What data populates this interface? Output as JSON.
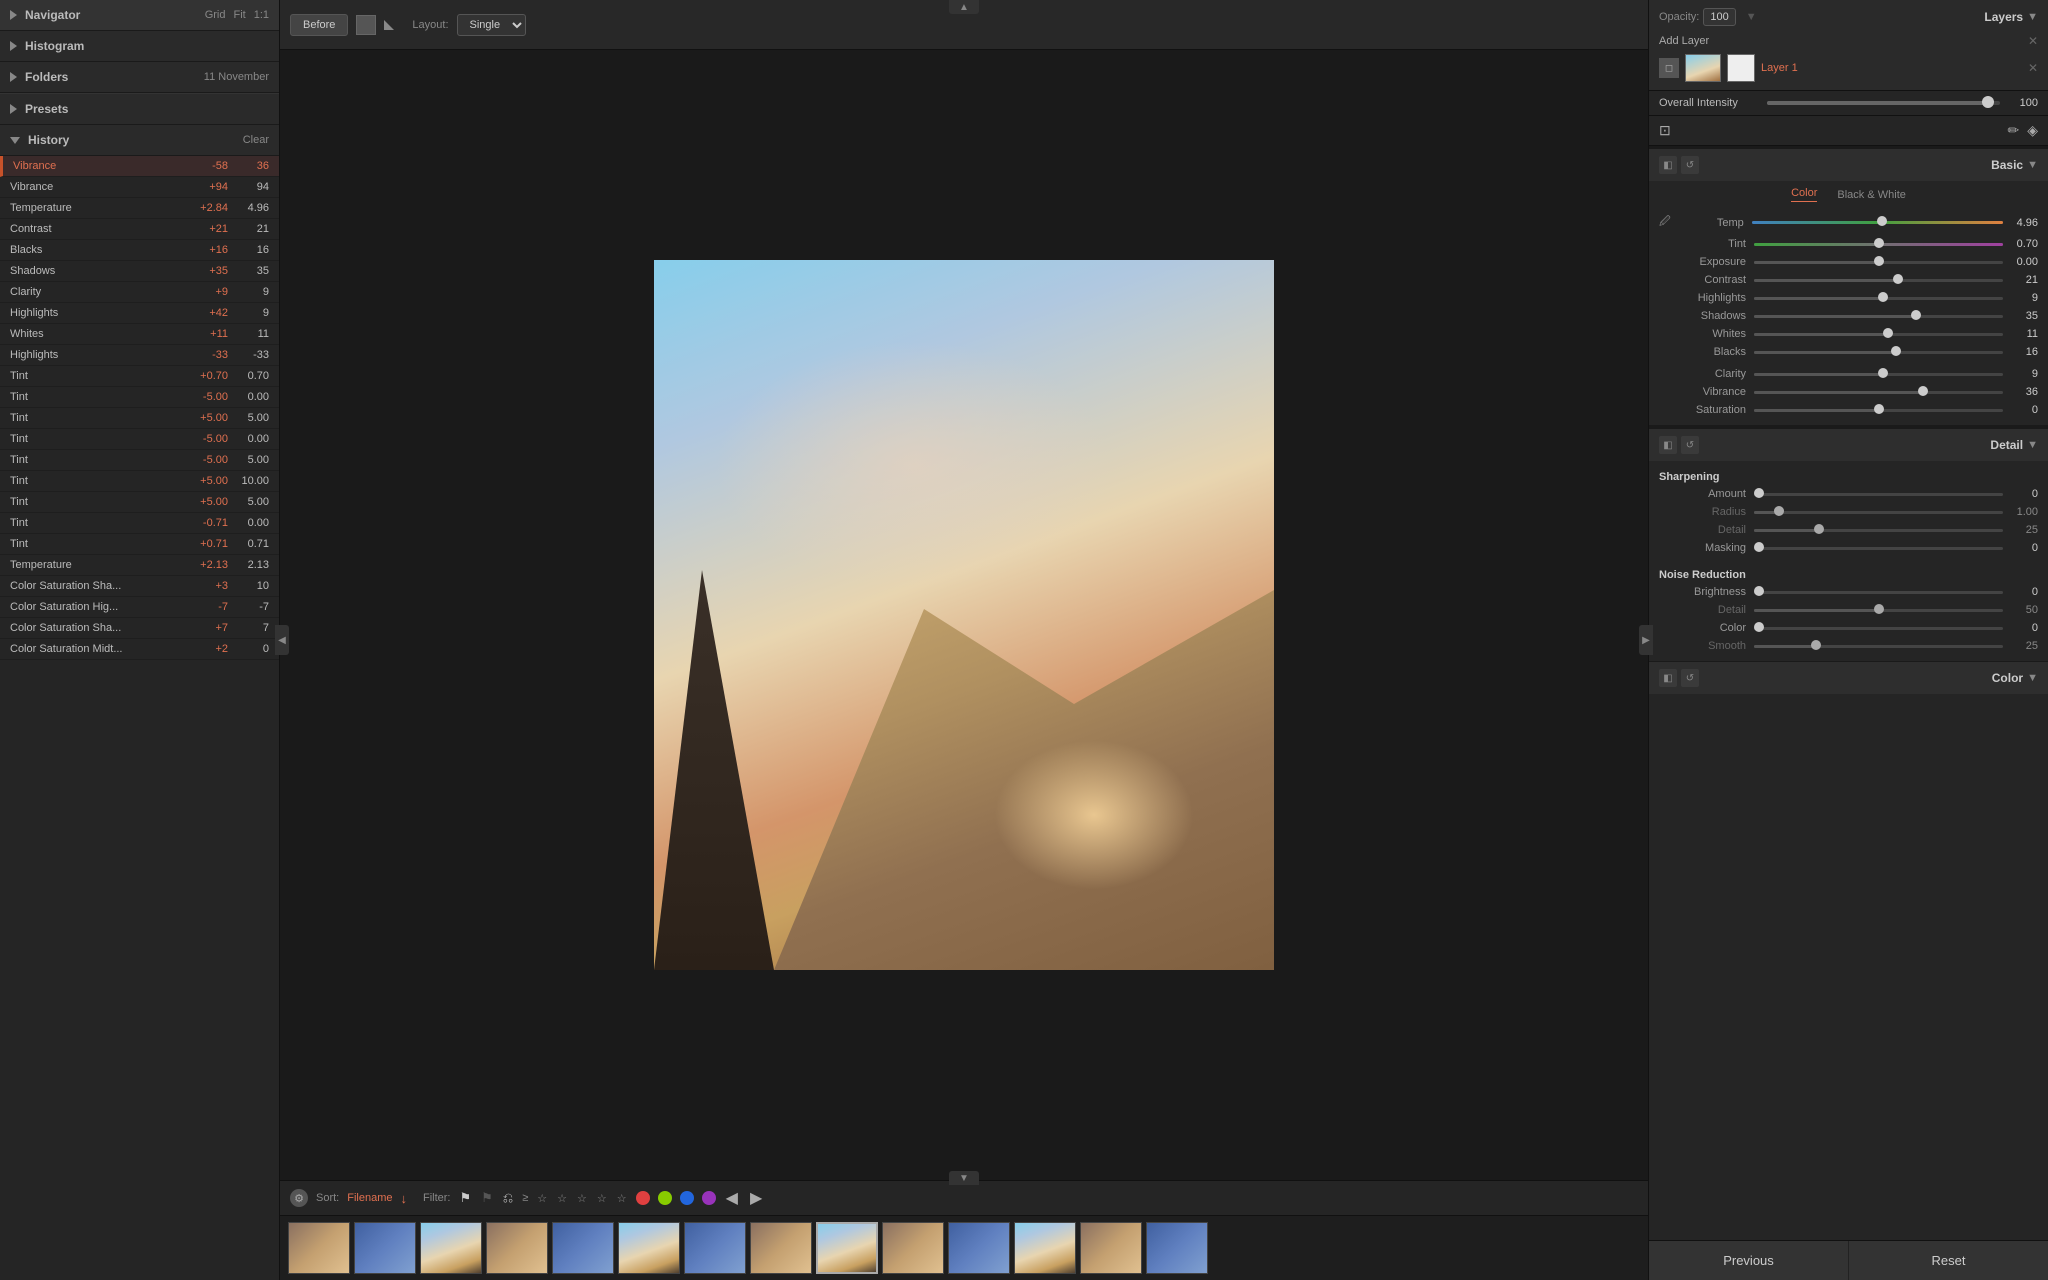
{
  "left": {
    "navigator": {
      "label": "Navigator",
      "grid": "Grid",
      "fit": "Fit",
      "ratio": "1:1"
    },
    "histogram": {
      "label": "Histogram"
    },
    "folders": {
      "label": "Folders",
      "date": "11 November"
    },
    "presets": {
      "label": "Presets"
    },
    "history": {
      "label": "History",
      "clear_btn": "Clear",
      "items": [
        {
          "name": "Vibrance",
          "val1": "-58",
          "val2": "36",
          "active": true
        },
        {
          "name": "Vibrance",
          "val1": "+94",
          "val2": "94",
          "active": false
        },
        {
          "name": "Temperature",
          "val1": "+2.84",
          "val2": "4.96",
          "active": false
        },
        {
          "name": "Contrast",
          "val1": "+21",
          "val2": "21",
          "active": false
        },
        {
          "name": "Blacks",
          "val1": "+16",
          "val2": "16",
          "active": false
        },
        {
          "name": "Shadows",
          "val1": "+35",
          "val2": "35",
          "active": false
        },
        {
          "name": "Clarity",
          "val1": "+9",
          "val2": "9",
          "active": false
        },
        {
          "name": "Highlights",
          "val1": "+42",
          "val2": "9",
          "active": false
        },
        {
          "name": "Whites",
          "val1": "+11",
          "val2": "11",
          "active": false
        },
        {
          "name": "Highlights",
          "val1": "-33",
          "val2": "-33",
          "active": false
        },
        {
          "name": "Tint",
          "val1": "+0.70",
          "val2": "0.70",
          "active": false
        },
        {
          "name": "Tint",
          "val1": "-5.00",
          "val2": "0.00",
          "active": false
        },
        {
          "name": "Tint",
          "val1": "+5.00",
          "val2": "5.00",
          "active": false
        },
        {
          "name": "Tint",
          "val1": "-5.00",
          "val2": "0.00",
          "active": false
        },
        {
          "name": "Tint",
          "val1": "-5.00",
          "val2": "5.00",
          "active": false
        },
        {
          "name": "Tint",
          "val1": "+5.00",
          "val2": "10.00",
          "active": false
        },
        {
          "name": "Tint",
          "val1": "+5.00",
          "val2": "5.00",
          "active": false
        },
        {
          "name": "Tint",
          "val1": "-0.71",
          "val2": "0.00",
          "active": false
        },
        {
          "name": "Tint",
          "val1": "+0.71",
          "val2": "0.71",
          "active": false
        },
        {
          "name": "Temperature",
          "val1": "+2.13",
          "val2": "2.13",
          "active": false
        },
        {
          "name": "Color Saturation Sha...",
          "val1": "+3",
          "val2": "10",
          "active": false
        },
        {
          "name": "Color Saturation Hig...",
          "val1": "-7",
          "val2": "-7",
          "active": false
        },
        {
          "name": "Color Saturation Sha...",
          "val1": "+7",
          "val2": "7",
          "active": false
        },
        {
          "name": "Color Saturation Midt...",
          "val1": "+2",
          "val2": "0",
          "active": false
        }
      ]
    }
  },
  "toolbar": {
    "before_btn": "Before",
    "layout_label": "Layout:",
    "layout_value": "Single"
  },
  "filmstrip": {
    "sort_label": "Sort:",
    "sort_value": "Filename",
    "filter_label": "Filter:",
    "colors": [
      "#ff4444",
      "#aadd00",
      "#3388ff",
      "#aa44cc"
    ],
    "thumbs": [
      {
        "type": "warm"
      },
      {
        "type": "blue"
      },
      {
        "type": "mountain"
      },
      {
        "type": "warm"
      },
      {
        "type": "blue"
      },
      {
        "type": "mountain"
      },
      {
        "type": "blue"
      },
      {
        "type": "warm"
      },
      {
        "type": "mountain",
        "active": true
      },
      {
        "type": "warm"
      },
      {
        "type": "blue"
      },
      {
        "type": "mountain"
      },
      {
        "type": "warm"
      },
      {
        "type": "blue"
      }
    ]
  },
  "right": {
    "opacity_label": "Opacity:",
    "opacity_value": "100",
    "layers_title": "Layers",
    "add_layer_label": "Add Layer",
    "layer_name": "Layer 1",
    "overall_intensity_label": "Overall Intensity",
    "overall_intensity_value": "100",
    "overall_intensity_pct": 95,
    "basic_title": "Basic",
    "color_tab": "Color",
    "bw_tab": "Black & White",
    "adjustments": {
      "temp": {
        "label": "Temp",
        "value": "4.96",
        "pct": 52
      },
      "tint": {
        "label": "Tint",
        "value": "0.70",
        "pct": 50
      },
      "exposure": {
        "label": "Exposure",
        "value": "0.00",
        "pct": 50
      },
      "contrast": {
        "label": "Contrast",
        "value": "21",
        "pct": 58
      },
      "highlights": {
        "label": "Highlights",
        "value": "9",
        "pct": 52
      },
      "shadows": {
        "label": "Shadows",
        "value": "35",
        "pct": 65
      },
      "whites": {
        "label": "Whites",
        "value": "11",
        "pct": 54
      },
      "blacks": {
        "label": "Blacks",
        "value": "16",
        "pct": 57
      },
      "clarity": {
        "label": "Clarity",
        "value": "9",
        "pct": 52
      },
      "vibrance": {
        "label": "Vibrance",
        "value": "36",
        "pct": 68
      },
      "saturation": {
        "label": "Saturation",
        "value": "0",
        "pct": 50
      }
    },
    "detail_title": "Detail",
    "sharpening": {
      "label": "Sharpening",
      "amount": {
        "label": "Amount",
        "value": "0",
        "pct": 2
      },
      "radius": {
        "label": "Radius",
        "value": "1.00",
        "pct": 10
      },
      "detail": {
        "label": "Detail",
        "value": "25",
        "pct": 26
      },
      "masking": {
        "label": "Masking",
        "value": "0",
        "pct": 2
      }
    },
    "noise_reduction": {
      "label": "Noise Reduction",
      "brightness": {
        "label": "Brightness",
        "value": "0",
        "pct": 2
      },
      "detail": {
        "label": "Detail",
        "value": "50",
        "pct": 50
      },
      "color": {
        "label": "Color",
        "value": "0",
        "pct": 2
      },
      "smooth": {
        "label": "Smooth",
        "value": "25",
        "pct": 25
      }
    },
    "color_section_title": "Color",
    "bottom_previous": "Previous",
    "bottom_reset": "Reset"
  }
}
